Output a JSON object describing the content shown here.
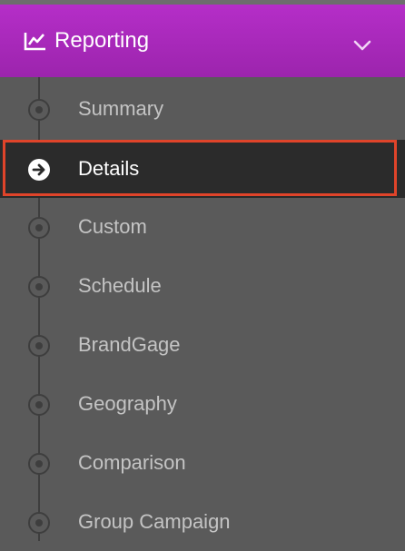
{
  "header": {
    "title": "Reporting",
    "icon": "line-chart-icon",
    "expand_icon": "chevron-down-icon",
    "gradient": [
      "#b52ec8",
      "#9c24ad"
    ]
  },
  "menu": {
    "items": [
      {
        "label": "Summary",
        "active": false
      },
      {
        "label": "Details",
        "active": true
      },
      {
        "label": "Custom",
        "active": false
      },
      {
        "label": "Schedule",
        "active": false
      },
      {
        "label": "BrandGage",
        "active": false
      },
      {
        "label": "Geography",
        "active": false
      },
      {
        "label": "Comparison",
        "active": false
      },
      {
        "label": "Group Campaign",
        "active": false
      }
    ],
    "highlight_color": "#e0442a"
  }
}
